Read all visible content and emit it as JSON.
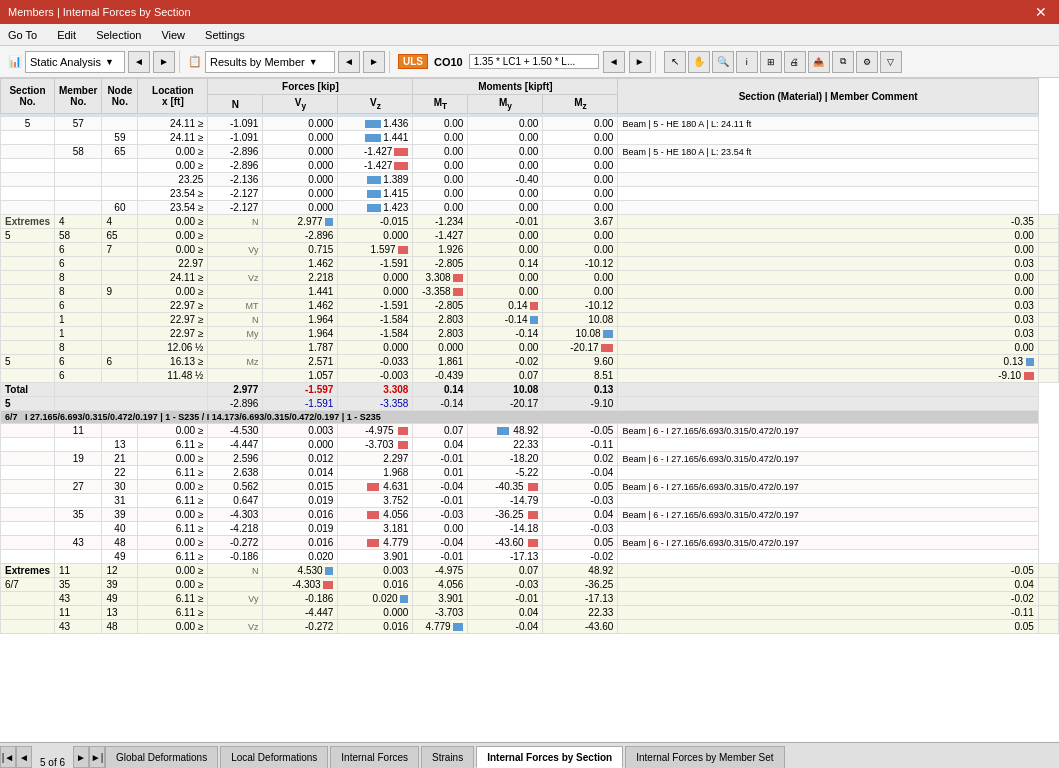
{
  "titleBar": {
    "title": "Members | Internal Forces by Section",
    "closeLabel": "✕"
  },
  "menu": {
    "items": [
      "Go To",
      "Edit",
      "Selection",
      "View",
      "Settings"
    ]
  },
  "toolbar": {
    "staticAnalysis": "Static Analysis",
    "resultsByMember": "Results by Member",
    "ulsLabel": "ULS",
    "coLabel": "CO10",
    "comboText": "1.35 * LC1 + 1.50 * L...",
    "navPrev": "◄",
    "navNext": "►"
  },
  "tableHeaders": {
    "sectionNo": "Section No.",
    "memberNo": "Member No.",
    "nodeNo": "Node No.",
    "locationX": "Location x [ft]",
    "forcesGroup": "Forces [kip]",
    "N": "N",
    "Vy": "Vy",
    "Vz": "Vz",
    "momentsGroup": "Moments [kipft]",
    "MT": "MT",
    "My": "My",
    "Mz": "Mz",
    "sectionMaterial": "Section (Material) | Member Comment"
  },
  "section1": {
    "sectionNo": "5",
    "memberNo": "57",
    "rows": [
      {
        "memberNo": "57",
        "nodeNo": "",
        "location": "24.11",
        "locSign": "≥",
        "N": "-1.091",
        "Vy": "0.000",
        "Vz": "1.436",
        "VzBar": 0.4,
        "VzPos": true,
        "MT": "0.00",
        "My": "0.00",
        "Mz": "0.00",
        "comment": "Beam | 5 - HE 180 A | L: 24.11 ft"
      },
      {
        "memberNo": "",
        "nodeNo": "59",
        "location": "24.11",
        "locSign": "≥",
        "N": "-1.091",
        "Vy": "0.000",
        "Vz": "1.441",
        "VzBar": 0.4,
        "VzPos": true,
        "MT": "0.00",
        "My": "0.00",
        "Mz": "0.00",
        "comment": ""
      },
      {
        "memberNo": "58",
        "nodeNo": "65",
        "location": "0.00",
        "locSign": "≥",
        "N": "-2.896",
        "Vy": "0.000",
        "Vz": "-1.427",
        "VzBar": 0.35,
        "VzPos": false,
        "MT": "0.00",
        "My": "0.00",
        "Mz": "0.00",
        "comment": "Beam | 5 - HE 180 A | L: 23.54 ft"
      },
      {
        "memberNo": "",
        "nodeNo": "",
        "location": "0.00",
        "locSign": "≥",
        "N": "-2.896",
        "Vy": "0.000",
        "Vz": "-1.427",
        "VzBar": 0.35,
        "VzPos": false,
        "MT": "0.00",
        "My": "0.00",
        "Mz": "0.00",
        "comment": ""
      },
      {
        "memberNo": "",
        "nodeNo": "",
        "location": "23.25",
        "locSign": "",
        "N": "-2.136",
        "Vy": "0.000",
        "Vz": "1.389",
        "VzBar": 0.35,
        "VzPos": true,
        "MT": "0.00",
        "My": "-0.40",
        "Mz": "0.00",
        "comment": ""
      },
      {
        "memberNo": "",
        "nodeNo": "",
        "location": "23.54",
        "locSign": "≥",
        "N": "-2.127",
        "Vy": "0.000",
        "Vz": "1.415",
        "VzBar": 0.35,
        "VzPos": true,
        "MT": "0.00",
        "My": "0.00",
        "Mz": "0.00",
        "comment": ""
      },
      {
        "memberNo": "",
        "nodeNo": "60",
        "location": "23.54",
        "locSign": "≥",
        "N": "-2.127",
        "Vy": "0.000",
        "Vz": "1.423",
        "VzBar": 0.35,
        "VzPos": true,
        "MT": "0.00",
        "My": "0.00",
        "Mz": "0.00",
        "comment": ""
      }
    ],
    "extremes": [
      {
        "type": "Extremes",
        "sectionNo": "4",
        "memberNo": "4",
        "nodeNo": "4",
        "location": "0.00",
        "locSign": "≥",
        "extremeLabel": "N",
        "N": "2.977",
        "NBarPos": true,
        "Vy": "-0.015",
        "Vz": "-1.234",
        "MT": "-0.01",
        "My": "3.67",
        "Mz": "-0.35",
        "comment": ""
      },
      {
        "type": "5",
        "sectionNo": "58",
        "memberNo": "65",
        "nodeNo": "",
        "location": "0.00",
        "locSign": "≥",
        "extremeLabel": "",
        "N": "-2.896",
        "Vy": "0.000",
        "Vz": "-1.427",
        "MT": "0.00",
        "My": "0.00",
        "Mz": "0.00",
        "comment": ""
      },
      {
        "type": "",
        "sectionNo": "6",
        "memberNo": "7",
        "nodeNo": "",
        "location": "0.00",
        "locSign": "≥",
        "extremeLabel": "Vy",
        "N": "0.715",
        "Vy": "1.597",
        "VyBarPos": true,
        "Vz": "1.926",
        "MT": "0.00",
        "My": "0.00",
        "Mz": "0.00",
        "comment": ""
      },
      {
        "type": "",
        "sectionNo": "6",
        "memberNo": "",
        "nodeNo": "",
        "location": "22.97",
        "locSign": "",
        "extremeLabel": "",
        "N": "1.462",
        "Vy": "-1.591",
        "Vz": "-2.805",
        "MT": "0.14",
        "My": "-10.12",
        "Mz": "0.03",
        "comment": ""
      },
      {
        "type": "",
        "sectionNo": "8",
        "memberNo": "",
        "nodeNo": "",
        "location": "24.11",
        "locSign": "≥",
        "extremeLabel": "Vz",
        "N": "2.218",
        "Vy": "0.000",
        "Vz": "3.308",
        "VzBarPos": true,
        "MT": "0.00",
        "My": "0.00",
        "Mz": "0.00",
        "comment": ""
      },
      {
        "type": "",
        "sectionNo": "8",
        "memberNo": "9",
        "nodeNo": "",
        "location": "0.00",
        "locSign": "≥",
        "extremeLabel": "",
        "N": "1.441",
        "Vy": "0.000",
        "Vz": "-3.358",
        "VzBarNeg": true,
        "MT": "0.00",
        "My": "0.00",
        "Mz": "0.00",
        "comment": ""
      },
      {
        "type": "",
        "sectionNo": "6",
        "memberNo": "",
        "nodeNo": "",
        "location": "22.97",
        "locSign": "≥",
        "extremeLabel": "MT",
        "N": "1.462",
        "Vy": "-1.591",
        "Vz": "-2.805",
        "MT": "0.14",
        "MTBarPos": true,
        "My": "-10.12",
        "Mz": "0.03",
        "comment": ""
      },
      {
        "type": "",
        "sectionNo": "1",
        "memberNo": "",
        "nodeNo": "",
        "location": "22.97",
        "locSign": "≥",
        "extremeLabel": "N",
        "N": "1.964",
        "Vy": "-1.584",
        "Vz": "2.803",
        "MT": "-0.14",
        "MTBarNeg": true,
        "My": "10.08",
        "Mz": "0.03",
        "comment": ""
      },
      {
        "type": "",
        "sectionNo": "1",
        "memberNo": "",
        "nodeNo": "",
        "location": "22.97",
        "locSign": "≥",
        "extremeLabel": "My",
        "N": "1.964",
        "Vy": "-1.584",
        "Vz": "2.803",
        "MT": "-0.14",
        "My": "10.08",
        "MyBarPos": true,
        "Mz": "0.03",
        "comment": ""
      },
      {
        "type": "",
        "sectionNo": "8",
        "memberNo": "",
        "nodeNo": "",
        "location": "12.06",
        "locSign": "½",
        "extremeLabel": "",
        "N": "1.787",
        "Vy": "0.000",
        "Vz": "0.000",
        "MT": "0.00",
        "My": "-20.17",
        "MyBarNeg": true,
        "Mz": "0.00",
        "comment": ""
      },
      {
        "type": "5",
        "sectionNo": "6",
        "memberNo": "",
        "nodeNo": "6",
        "location": "16.13",
        "locSign": "≥",
        "extremeLabel": "Mz",
        "N": "2.571",
        "Vy": "-0.033",
        "Vz": "1.861",
        "MT": "-0.02",
        "My": "9.60",
        "Mz": "0.13",
        "MzBarPos": true,
        "comment": ""
      },
      {
        "type": "",
        "sectionNo": "6",
        "memberNo": "",
        "nodeNo": "",
        "location": "11.48",
        "locSign": "½",
        "extremeLabel": "",
        "N": "1.057",
        "Vy": "-0.003",
        "Vz": "-0.439",
        "MT": "0.07",
        "My": "8.51",
        "Mz": "-9.10",
        "MzBarNeg": true,
        "comment": ""
      }
    ],
    "total": {
      "N": "2.977",
      "Vy": "-1.597",
      "Vz": "3.308",
      "MT": "0.14",
      "My": "10.08",
      "Mz": "0.13"
    },
    "total2": {
      "N": "-2.896",
      "Vy": "-1.591",
      "Vz": "-3.358",
      "MT": "-0.14",
      "My": "-20.17",
      "Mz": "-9.10"
    }
  },
  "section2": {
    "headerText": "I 27.165/6.693/0.315/0.472/0.197 | 1 - S235 / I 14.173/6.693/0.315/0.472/0.197 | 1 - S235",
    "sectionNo": "6/7",
    "rows": [
      {
        "memberNo": "11",
        "nodeNo": "",
        "location": "0.00",
        "locSign": "≥",
        "N": "-4.530",
        "Vy": "0.003",
        "Vz": "-4.975",
        "VzBarNeg": true,
        "MT": "0.07",
        "My": "48.92",
        "MyBarPos": true,
        "Mz": "-0.05",
        "comment": "Beam | 6 - I 27.165/6.693/0.315/0.472/0.197"
      },
      {
        "memberNo": "",
        "nodeNo": "13",
        "location": "6.11",
        "locSign": "≥",
        "N": "-4.447",
        "Vy": "0.000",
        "Vz": "-3.703",
        "VzBarNeg": true,
        "MT": "0.04",
        "My": "22.33",
        "Mz": "-0.11",
        "comment": ""
      },
      {
        "memberNo": "19",
        "nodeNo": "21",
        "location": "0.00",
        "locSign": "≥",
        "N": "2.596",
        "Vy": "0.012",
        "Vz": "2.297",
        "MT": "-0.01",
        "My": "-18.20",
        "Mz": "0.02",
        "comment": "Beam | 6 - I 27.165/6.693/0.315/0.472/0.197"
      },
      {
        "memberNo": "",
        "nodeNo": "22",
        "location": "6.11",
        "locSign": "≥",
        "N": "2.638",
        "Vy": "0.014",
        "Vz": "1.968",
        "MT": "0.01",
        "My": "-5.22",
        "Mz": "-0.04",
        "comment": ""
      },
      {
        "memberNo": "27",
        "nodeNo": "30",
        "location": "0.00",
        "locSign": "≥",
        "N": "0.562",
        "Vy": "0.015",
        "Vz": "4.631",
        "VzBarPos": true,
        "MT": "-0.04",
        "My": "-40.35",
        "MyBarNeg": true,
        "Mz": "0.05",
        "comment": "Beam | 6 - I 27.165/6.693/0.315/0.472/0.197"
      },
      {
        "memberNo": "",
        "nodeNo": "31",
        "location": "6.11",
        "locSign": "≥",
        "N": "0.647",
        "Vy": "0.019",
        "Vz": "3.752",
        "MT": "-0.01",
        "My": "-14.79",
        "Mz": "-0.03",
        "comment": ""
      },
      {
        "memberNo": "35",
        "nodeNo": "39",
        "location": "0.00",
        "locSign": "≥",
        "N": "-4.303",
        "Vy": "0.016",
        "Vz": "4.056",
        "VzBarPos": true,
        "MT": "-0.03",
        "My": "-36.25",
        "MyBarNeg": true,
        "Mz": "0.04",
        "comment": "Beam | 6 - I 27.165/6.693/0.315/0.472/0.197"
      },
      {
        "memberNo": "",
        "nodeNo": "40",
        "location": "6.11",
        "locSign": "≥",
        "N": "-4.218",
        "Vy": "0.019",
        "Vz": "3.181",
        "MT": "0.00",
        "My": "-14.18",
        "Mz": "-0.03",
        "comment": ""
      },
      {
        "memberNo": "43",
        "nodeNo": "48",
        "location": "0.00",
        "locSign": "≥",
        "N": "-0.272",
        "Vy": "0.016",
        "Vz": "4.779",
        "VzBarPos": true,
        "MT": "-0.04",
        "My": "-43.60",
        "MyBarNeg": true,
        "Mz": "0.05",
        "comment": "Beam | 6 - I 27.165/6.693/0.315/0.472/0.197"
      },
      {
        "memberNo": "",
        "nodeNo": "49",
        "location": "6.11",
        "locSign": "≥",
        "N": "-0.186",
        "Vy": "0.020",
        "Vz": "3.901",
        "MT": "-0.01",
        "My": "-17.13",
        "Mz": "-0.02",
        "comment": ""
      }
    ],
    "extremes": [
      {
        "type": "Extremes",
        "sectionNo": "11",
        "memberNo": "12",
        "location": "0.00",
        "locSign": "≥",
        "extremeLabel": "N",
        "N": "4.530",
        "NBarPos": true,
        "Vy": "0.003",
        "Vz": "-4.975",
        "MT": "0.07",
        "My": "48.92",
        "Mz": "-0.05"
      },
      {
        "type": "6/7",
        "sectionNo": "35",
        "memberNo": "39",
        "location": "0.00",
        "locSign": "≥",
        "extremeLabel": "",
        "N": "-4.303",
        "NBarNeg": true,
        "Vy": "0.016",
        "Vz": "4.056",
        "MT": "-0.03",
        "My": "-36.25",
        "Mz": "0.04"
      },
      {
        "type": "",
        "sectionNo": "43",
        "memberNo": "49",
        "location": "6.11",
        "locSign": "≥",
        "extremeLabel": "Vy",
        "N": "-0.186",
        "Vy": "0.020",
        "VyBarPos": true,
        "Vz": "3.901",
        "MT": "-0.01",
        "My": "-17.13",
        "Mz": "-0.02"
      },
      {
        "type": "",
        "sectionNo": "11",
        "memberNo": "13",
        "location": "6.11",
        "locSign": "≥",
        "extremeLabel": "",
        "N": "-4.447",
        "Vy": "0.000",
        "Vz": "-3.703",
        "MT": "0.04",
        "My": "22.33",
        "Mz": "-0.11"
      },
      {
        "type": "",
        "sectionNo": "43",
        "memberNo": "48",
        "location": "0.00",
        "locSign": "≥",
        "extremeLabel": "Vz",
        "N": "-0.272",
        "Vy": "0.016",
        "Vz": "4.779",
        "VzBarPos": true,
        "MT": "-0.04",
        "My": "-43.60",
        "Mz": "0.05"
      }
    ]
  },
  "tabs": {
    "pageIndicator": "5 of 6",
    "items": [
      "Global Deformations",
      "Local Deformations",
      "Internal Forces",
      "Strains",
      "Internal Forces by Section",
      "Internal Forces by Member Set"
    ],
    "activeTab": "Internal Forces by Section"
  }
}
